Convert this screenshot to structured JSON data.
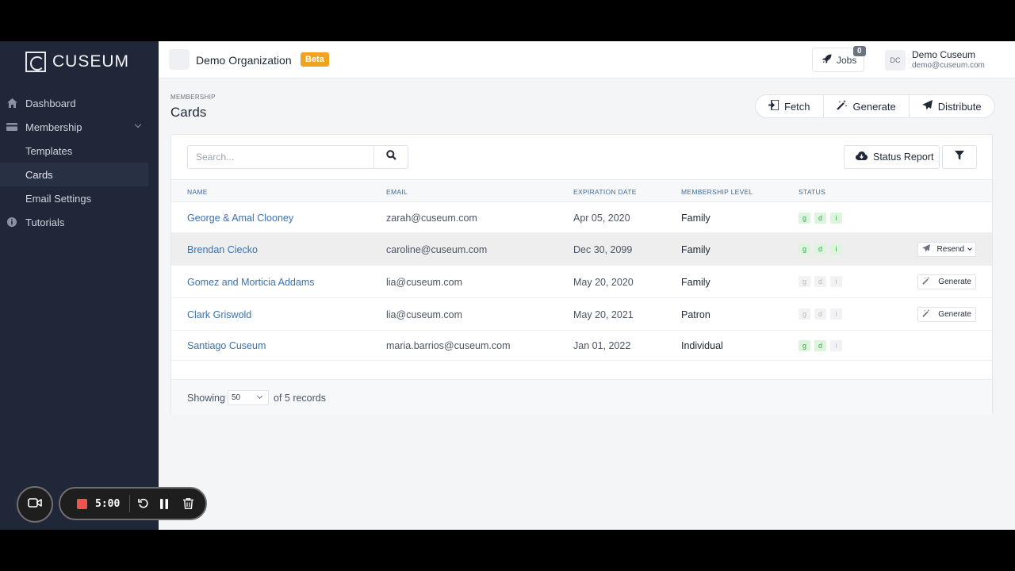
{
  "sidebar": {
    "brand": "CUSEUM",
    "items": [
      {
        "label": "Dashboard",
        "icon": "home-icon"
      },
      {
        "label": "Membership",
        "icon": "card-icon"
      },
      {
        "label": "Templates"
      },
      {
        "label": "Cards"
      },
      {
        "label": "Email Settings"
      },
      {
        "label": "Tutorials",
        "icon": "info-icon"
      }
    ]
  },
  "topbar": {
    "org_name": "Demo Organization",
    "beta_label": "Beta",
    "jobs_label": "Jobs",
    "jobs_count": "0",
    "user_initials": "DC",
    "user_name": "Demo Cuseum",
    "user_email": "demo@cuseum.com"
  },
  "page": {
    "breadcrumb": "MEMBERSHIP",
    "title": "Cards",
    "actions": {
      "fetch": "Fetch",
      "generate": "Generate",
      "distribute": "Distribute"
    }
  },
  "toolbar": {
    "search_placeholder": "Search...",
    "status_report": "Status Report"
  },
  "table": {
    "headers": {
      "name": "NAME",
      "email": "EMAIL",
      "exp": "EXPIRATION DATE",
      "level": "MEMBERSHIP LEVEL",
      "status": "STATUS"
    },
    "rows": [
      {
        "name": "George & Amal Clooney",
        "email": "zarah@cuseum.com",
        "exp": "Apr 05, 2020",
        "level": "Family",
        "status": [
          "on",
          "on",
          "on"
        ],
        "action": ""
      },
      {
        "name": "Brendan Ciecko",
        "email": "caroline@cuseum.com",
        "exp": "Dec 30, 2099",
        "level": "Family",
        "status": [
          "on",
          "on",
          "on"
        ],
        "action": "Resend"
      },
      {
        "name": "Gomez and Morticia Addams",
        "email": "lia@cuseum.com",
        "exp": "May 20, 2020",
        "level": "Family",
        "status": [
          "off",
          "off",
          "off"
        ],
        "action": "Generate"
      },
      {
        "name": "Clark Griswold",
        "email": "lia@cuseum.com",
        "exp": "May 20, 2021",
        "level": "Patron",
        "status": [
          "off",
          "off",
          "off"
        ],
        "action": "Generate"
      },
      {
        "name": "Santiago Cuseum",
        "email": "maria.barrios@cuseum.com",
        "exp": "Jan 01, 2022",
        "level": "Individual",
        "status": [
          "on",
          "on",
          "off"
        ],
        "action": ""
      }
    ],
    "status_letters": [
      "g",
      "d",
      "i"
    ]
  },
  "footer": {
    "showing": "Showing",
    "per_page": "50",
    "records": "of 5 records"
  },
  "recorder": {
    "time": "5:00"
  },
  "colors": {
    "sidebar_bg": "#1f2738",
    "beta": "#f0a321",
    "link": "#3a72b0",
    "status_on": "#34a853",
    "record": "#ef5350"
  }
}
